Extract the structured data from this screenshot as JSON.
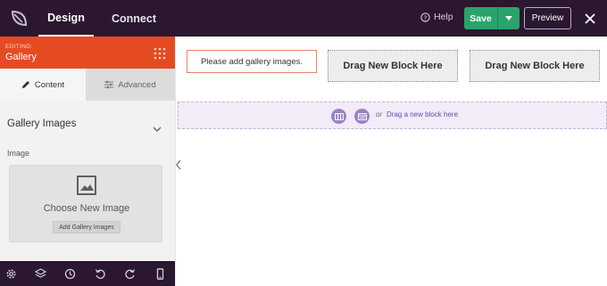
{
  "topbar": {
    "tabs": [
      {
        "label": "Design",
        "active": true
      },
      {
        "label": "Connect",
        "active": false
      }
    ],
    "help_label": "Help",
    "save_label": "Save",
    "preview_label": "Preview"
  },
  "sidebar": {
    "editing_label": "EDITING:",
    "editing_title": "Gallery",
    "tabs": [
      {
        "label": "Content",
        "icon": "pencil-icon",
        "active": true
      },
      {
        "label": "Advanced",
        "icon": "sliders-icon",
        "active": false
      }
    ],
    "section_title": "Gallery Images",
    "image_label": "Image",
    "choose_label": "Choose New Image",
    "add_button_label": "Add Gallery Images",
    "bottom_icons": [
      "gear-icon",
      "layers-icon",
      "history-icon",
      "undo-icon",
      "redo-icon",
      "mobile-icon"
    ]
  },
  "canvas": {
    "gallery_placeholder": "Please add gallery images.",
    "drag_blocks": [
      "Drag New Block Here",
      "Drag New Block Here"
    ],
    "drop_or": "or",
    "drop_link": "Drag a new block here"
  },
  "colors": {
    "topbar_bg": "#2b1730",
    "accent_orange": "#e44b22",
    "save_green": "#2aa36b",
    "drop_purple": "#6b46ad"
  }
}
